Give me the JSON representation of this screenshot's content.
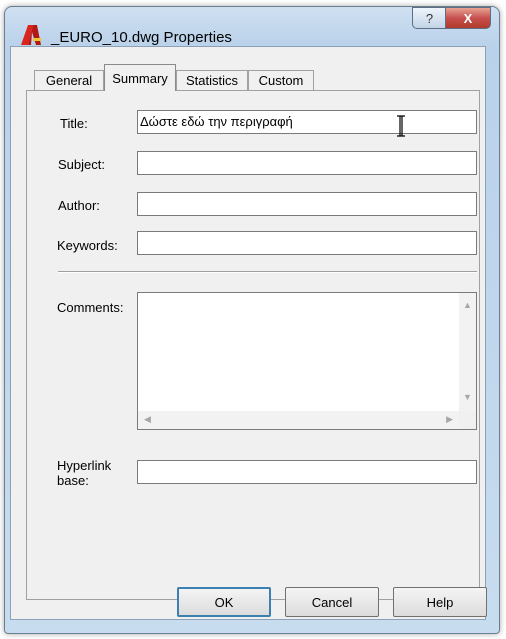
{
  "window": {
    "title": "_EURO_10.dwg Properties",
    "help_glyph": "?",
    "close_glyph": "X"
  },
  "tabs": [
    {
      "label": "General",
      "active": false
    },
    {
      "label": "Summary",
      "active": true
    },
    {
      "label": "Statistics",
      "active": false
    },
    {
      "label": "Custom",
      "active": false
    }
  ],
  "summary": {
    "title_label": "Title:",
    "title_value": "Δώστε εδώ την περιγραφή",
    "subject_label": "Subject:",
    "subject_value": "",
    "author_label": "Author:",
    "author_value": "",
    "keywords_label": "Keywords:",
    "keywords_value": "",
    "comments_label": "Comments:",
    "comments_value": "",
    "hyperlink_label_line1": "Hyperlink",
    "hyperlink_label_line2": "base:",
    "hyperlink_value": ""
  },
  "buttons": {
    "ok": "OK",
    "cancel": "Cancel",
    "help": "Help"
  },
  "colors": {
    "accent": "#3c7fb1",
    "close": "#c75050",
    "app_icon": "#d9251d"
  }
}
